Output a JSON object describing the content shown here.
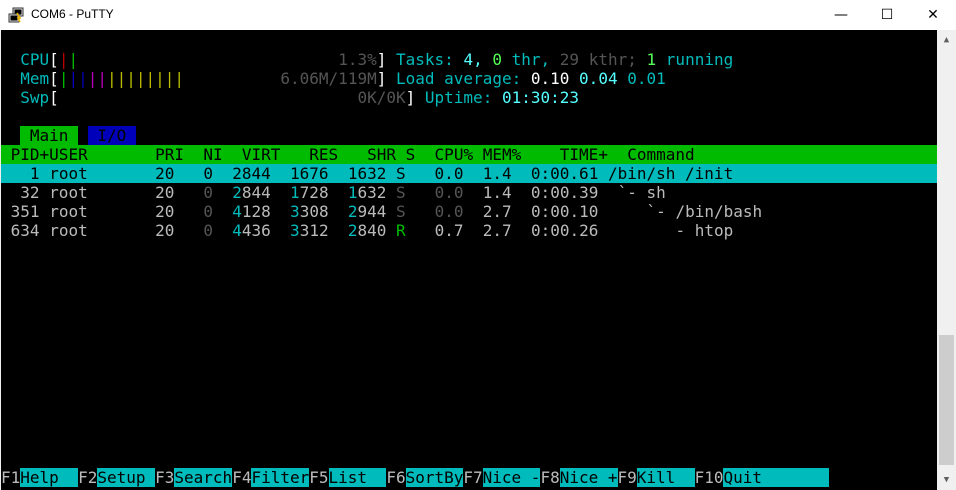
{
  "window": {
    "title": "COM6 - PuTTY",
    "minimize_glyph": "—",
    "maximize_glyph": "☐",
    "close_glyph": "✕",
    "scroll_up_glyph": "▲",
    "scroll_down_glyph": "▼",
    "icon": "putty-icon"
  },
  "meters": {
    "cpu_label": "CPU",
    "cpu_bars_red": "|",
    "cpu_bars_green": "|",
    "cpu_value": "1.3%",
    "mem_label": "Mem",
    "mem_bars_green": "|",
    "mem_bars_blue": "||",
    "mem_bars_magenta": "||",
    "mem_bars_yellow": "||||||||",
    "mem_value_used": "6.06M",
    "mem_value_total": "/119M",
    "swp_label": "Swp",
    "swp_value_used": "0K",
    "swp_value_total": "/0K",
    "open_bracket": "[",
    "close_bracket": "]"
  },
  "summary": {
    "tasks_label": "Tasks:",
    "tasks_count": "4,",
    "thr_count": "0",
    "thr_label": "thr,",
    "kthr_count": "29",
    "kthr_label": "kthr;",
    "running_count": "1",
    "running_label": "running",
    "load_label": "Load average:",
    "load_1": "0.10",
    "load_5": "0.04",
    "load_15": "0.01",
    "uptime_label": "Uptime:",
    "uptime_value": "01:30:23"
  },
  "tabs": {
    "main": " Main ",
    "io": " I/O "
  },
  "columns": {
    "pid": "PID+",
    "user": "USER",
    "pri": "PRI",
    "ni": "NI",
    "virt": "VIRT",
    "res": "RES",
    "shr": "SHR",
    "s": "S",
    "cpu": "CPU%",
    "mem": "MEM%",
    "time": "TIME+",
    "command": "Command"
  },
  "processes": [
    {
      "pid": "1",
      "user": "root",
      "pri": "20",
      "ni": "0",
      "virt_a": "",
      "virt_b": "2844",
      "res_a": "",
      "res_b": "1676",
      "shr_a": "",
      "shr_b": "1632",
      "s": "S",
      "cpu": "0.0",
      "mem": "1.4",
      "time": "0:00.61",
      "tree": "",
      "cmd": "/bin/sh /init"
    },
    {
      "pid": "32",
      "user": "root",
      "pri": "20",
      "ni": "0",
      "virt_a": "2",
      "virt_b": "844",
      "res_a": "1",
      "res_b": "728",
      "shr_a": "1",
      "shr_b": "632",
      "s": "S",
      "cpu": "0.0",
      "mem": "1.4",
      "time": "0:00.39",
      "tree": "`-",
      "cmd": "sh"
    },
    {
      "pid": "351",
      "user": "root",
      "pri": "20",
      "ni": "0",
      "virt_a": "4",
      "virt_b": "128",
      "res_a": "3",
      "res_b": "308",
      "shr_a": "2",
      "shr_b": "944",
      "s": "S",
      "cpu": "0.0",
      "mem": "2.7",
      "time": "0:00.10",
      "tree": "`-",
      "cmd": "/bin/bash"
    },
    {
      "pid": "634",
      "user": "root",
      "pri": "20",
      "ni": "0",
      "virt_a": "4",
      "virt_b": "436",
      "res_a": "3",
      "res_b": "312",
      "shr_a": "2",
      "shr_b": "840",
      "s": "R",
      "cpu": "0.7",
      "mem": "2.7",
      "time": "0:00.26",
      "tree": "-",
      "cmd": "htop"
    }
  ],
  "function_keys": [
    {
      "key": "F1",
      "label": "Help  "
    },
    {
      "key": "F2",
      "label": "Setup "
    },
    {
      "key": "F3",
      "label": "Search"
    },
    {
      "key": "F4",
      "label": "Filter"
    },
    {
      "key": "F5",
      "label": "List  "
    },
    {
      "key": "F6",
      "label": "SortBy"
    },
    {
      "key": "F7",
      "label": "Nice -"
    },
    {
      "key": "F8",
      "label": "Nice +"
    },
    {
      "key": "F9",
      "label": "Kill  "
    },
    {
      "key": "F10",
      "label": "Quit       "
    }
  ]
}
